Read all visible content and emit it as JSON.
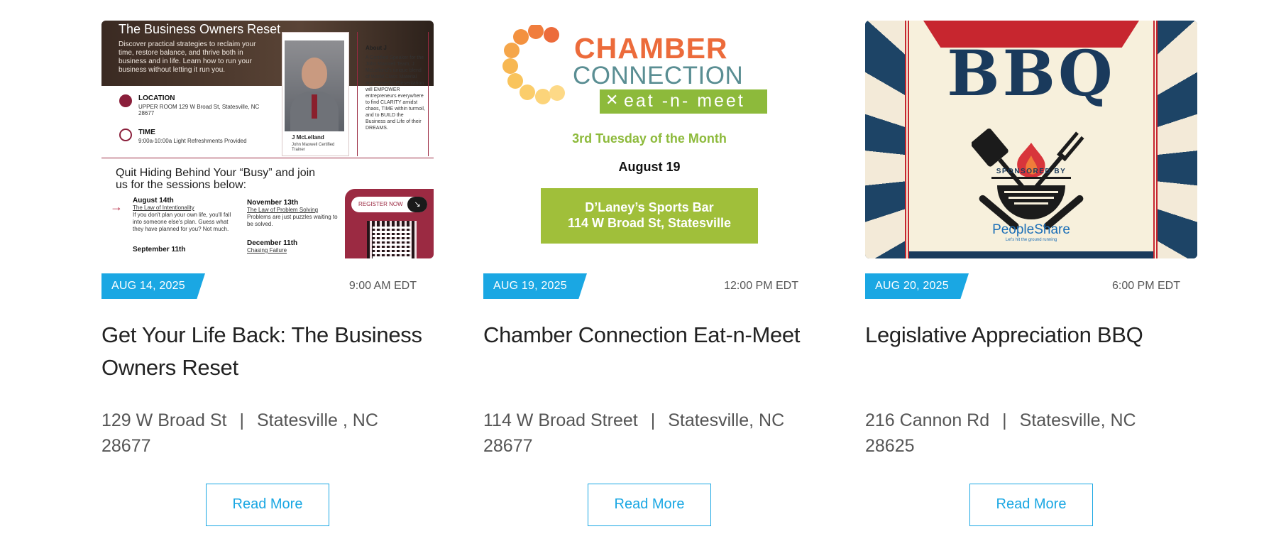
{
  "events": [
    {
      "date": "AUG 14, 2025",
      "time": "9:00 AM EDT",
      "title": "Get Your Life Back: The Business Owners Reset",
      "address_street": "129 W Broad St",
      "address_city": "Statesville , NC",
      "address_zip": "28677",
      "read_more": "Read More",
      "poster": {
        "heading": "The Business Owners Reset",
        "description": "Discover practical strategies to reclaim your time, restore balance, and thrive both in business and in life. Learn how to run your business without letting it run you.",
        "location_label": "LOCATION",
        "location_value": "UPPER ROOM 129 W Broad St, Statesville, NC 28677",
        "time_label": "TIME",
        "time_value": "9:00a-10:00a Light Refreshments Provided",
        "speaker_name": "J McLelland",
        "speaker_role": "John Maxwell Certified Trainer",
        "about_heading": "About J",
        "about_text": "A Certified Speaker for the John Maxwell Team, J McLelland's unique blend of World Class Material and Powerful Presentation will EMPOWER entrepreneurs everywhere to find CLARITY amidst chaos, TIME within turmoil, and to BUILD the Business and Life of their DREAMS.",
        "quit_text": "Quit Hiding Behind Your “Busy” and join us for the sessions below:",
        "session1_date": "August 14th",
        "session1_title": "The Law of Intentionality",
        "session1_text": "If you don't plan your own life, you'll fall into someone else's plan. Guess what they have planned for you? Not much.",
        "session2_date": "November 13th",
        "session2_title": "The Law of Problem Solving",
        "session2_text": "Problems are just puzzles waiting to be solved.",
        "session3_date": "December 11th",
        "session3_title": "Chasing Failure",
        "session4_date": "September 11th",
        "register_label": "REGISTER NOW"
      }
    },
    {
      "date": "AUG 19, 2025",
      "time": "12:00 PM EDT",
      "title": "Chamber Connection Eat-n-Meet",
      "address_street": "114 W Broad Street",
      "address_city": "Statesville, NC",
      "address_zip": "28677",
      "read_more": "Read More",
      "poster": {
        "word1": "CHAMBER",
        "word2": "CONNECTION",
        "tagline": "eat -n- meet",
        "recurrence": "3rd Tuesday of the Month",
        "date": "August 19",
        "venue_line1": "D’Laney’s Sports Bar",
        "venue_line2": "114 W Broad St, Statesville"
      }
    },
    {
      "date": "AUG 20, 2025",
      "time": "6:00 PM EDT",
      "title": "Legislative Appreciation BBQ",
      "address_street": "216 Cannon Rd",
      "address_city": "Statesville, NC",
      "address_zip": "28625",
      "read_more": "Read More",
      "poster": {
        "heading": "BBQ",
        "sponsored_by": "SPONSORED BY",
        "sponsor": "PeopleShare",
        "sponsor_tagline": "Let's hit the ground running"
      }
    }
  ],
  "colors": {
    "accent": "#1aa7e3",
    "title": "#222222",
    "muted": "#555555"
  }
}
